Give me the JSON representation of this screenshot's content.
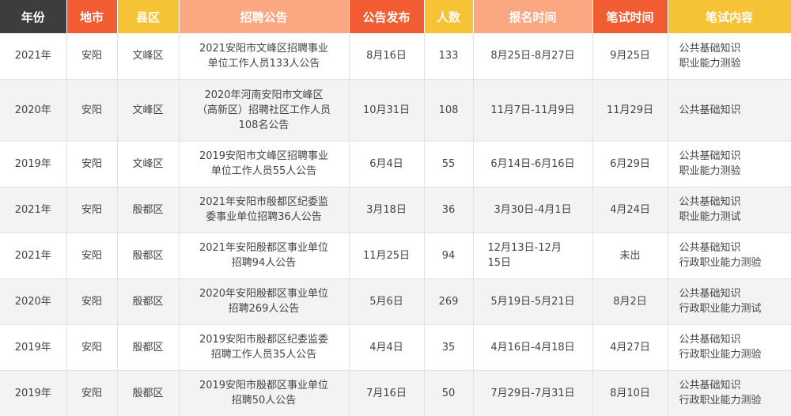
{
  "header": {
    "columns": [
      {
        "label": "年份",
        "bg": "#3d3d3d"
      },
      {
        "label": "地市",
        "bg": "#f25c33"
      },
      {
        "label": "县区",
        "bg": "#f7c336"
      },
      {
        "label": "招聘公告",
        "bg": "#fba882"
      },
      {
        "label": "公告发布",
        "bg": "#f25c33"
      },
      {
        "label": "人数",
        "bg": "#f7c336"
      },
      {
        "label": "报名时间",
        "bg": "#fba882"
      },
      {
        "label": "笔试时间",
        "bg": "#f25c33"
      },
      {
        "label": "笔试内容",
        "bg": "#f7c336"
      }
    ]
  },
  "rows": [
    {
      "year": "2021年",
      "city": "安阳",
      "district": "文峰区",
      "announcement": [
        "2021安阳市文峰区招聘事业",
        "单位工作人员133人公告"
      ],
      "publish": "8月16日",
      "count": "133",
      "registration": [
        "8月25日-8月27日"
      ],
      "exam_date": "9月25日",
      "exam_content": [
        "公共基础知识",
        "职业能力测验"
      ]
    },
    {
      "year": "2020年",
      "city": "安阳",
      "district": "文峰区",
      "announcement": [
        "2020年河南安阳市文峰区",
        "（高新区）招聘社区工作人员",
        "108名公告"
      ],
      "publish": "10月31日",
      "count": "108",
      "registration": [
        "11月7日-11月9日"
      ],
      "exam_date": "11月29日",
      "exam_content": [
        "公共基础知识"
      ]
    },
    {
      "year": "2019年",
      "city": "安阳",
      "district": "文峰区",
      "announcement": [
        "2019安阳市文峰区招聘事业",
        "单位工作人员55人公告"
      ],
      "publish": "6月4日",
      "count": "55",
      "registration": [
        "6月14日-6月16日"
      ],
      "exam_date": "6月29日",
      "exam_content": [
        "公共基础知识",
        "职业能力测验"
      ]
    },
    {
      "year": "2021年",
      "city": "安阳",
      "district": "殷都区",
      "announcement": [
        "2021年安阳市殷都区纪委监",
        "委事业单位招聘36人公告"
      ],
      "publish": "3月18日",
      "count": "36",
      "registration": [
        "3月30日-4月1日"
      ],
      "exam_date": "4月24日",
      "exam_content": [
        "公共基础知识",
        "职业能力测试"
      ]
    },
    {
      "year": "2021年",
      "city": "安阳",
      "district": "殷都区",
      "announcement": [
        "2021年安阳殷都区事业单位",
        "招聘94人公告"
      ],
      "publish": "11月25日",
      "count": "94",
      "registration": [
        "12月13日-12月",
        "15日"
      ],
      "exam_date": "未出",
      "exam_content": [
        "公共基础知识",
        "行政职业能力测验"
      ]
    },
    {
      "year": "2020年",
      "city": "安阳",
      "district": "殷都区",
      "announcement": [
        "2020年安阳殷都区事业单位",
        "招聘269人公告"
      ],
      "publish": "5月6日",
      "count": "269",
      "registration": [
        "5月19日-5月21日"
      ],
      "exam_date": "8月2日",
      "exam_content": [
        "公共基础知识",
        "行政职业能力测试"
      ]
    },
    {
      "year": "2019年",
      "city": "安阳",
      "district": "殷都区",
      "announcement": [
        "2019安阳市殷都区纪委监委",
        "招聘工作人员35人公告"
      ],
      "publish": "4月4日",
      "count": "35",
      "registration": [
        "4月16日-4月18日"
      ],
      "exam_date": "4月27日",
      "exam_content": [
        "公共基础知识",
        "行政职业能力测验"
      ]
    },
    {
      "year": "2019年",
      "city": "安阳",
      "district": "殷都区",
      "announcement": [
        "2019安阳市殷都区事业单位",
        "招聘50人公告"
      ],
      "publish": "7月16日",
      "count": "50",
      "registration": [
        "7月29日-7月31日"
      ],
      "exam_date": "8月10日",
      "exam_content": [
        "公共基础知识",
        "行政职业能力测验"
      ]
    }
  ]
}
